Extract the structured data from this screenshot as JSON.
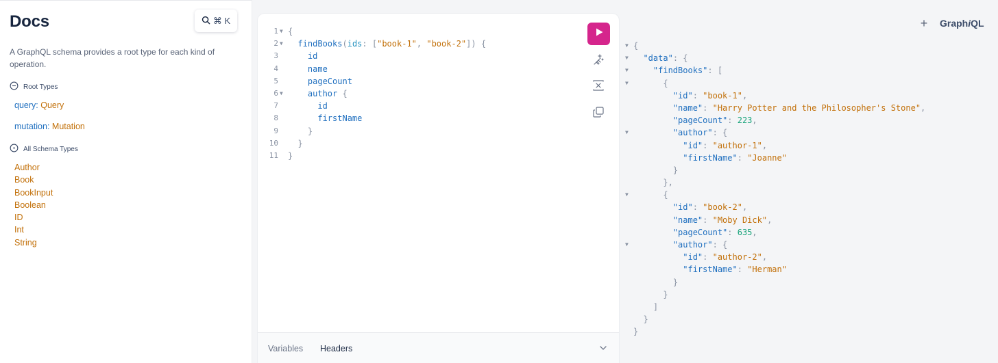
{
  "docs": {
    "title": "Docs",
    "search_label": "⌘ K",
    "description": "A GraphQL schema provides a root type for each kind of operation.",
    "root_types_heading": "Root Types",
    "root_fields": [
      {
        "name": "query",
        "type": "Query"
      },
      {
        "name": "mutation",
        "type": "Mutation"
      }
    ],
    "all_types_heading": "All Schema Types",
    "types": [
      "Author",
      "Book",
      "BookInput",
      "Boolean",
      "ID",
      "Int",
      "String"
    ]
  },
  "editor": {
    "query_lines": [
      {
        "n": "1",
        "fold": true,
        "tokens": [
          {
            "t": "{",
            "c": "k-punc"
          }
        ]
      },
      {
        "n": "2",
        "fold": true,
        "tokens": [
          {
            "t": "  "
          },
          {
            "t": "findBooks",
            "c": "k-field"
          },
          {
            "t": "(",
            "c": "k-punc"
          },
          {
            "t": "ids",
            "c": "k-arg"
          },
          {
            "t": ": ",
            "c": "k-punc"
          },
          {
            "t": "[",
            "c": "k-punc"
          },
          {
            "t": "\"book-1\"",
            "c": "k-str"
          },
          {
            "t": ", ",
            "c": "k-punc"
          },
          {
            "t": "\"book-2\"",
            "c": "k-str"
          },
          {
            "t": "]) {",
            "c": "k-punc"
          }
        ]
      },
      {
        "n": "3",
        "fold": false,
        "tokens": [
          {
            "t": "    "
          },
          {
            "t": "id",
            "c": "k-field"
          }
        ]
      },
      {
        "n": "4",
        "fold": false,
        "tokens": [
          {
            "t": "    "
          },
          {
            "t": "name",
            "c": "k-field"
          }
        ]
      },
      {
        "n": "5",
        "fold": false,
        "tokens": [
          {
            "t": "    "
          },
          {
            "t": "pageCount",
            "c": "k-field"
          }
        ]
      },
      {
        "n": "6",
        "fold": true,
        "tokens": [
          {
            "t": "    "
          },
          {
            "t": "author",
            "c": "k-field"
          },
          {
            "t": " {",
            "c": "k-punc"
          }
        ]
      },
      {
        "n": "7",
        "fold": false,
        "tokens": [
          {
            "t": "      "
          },
          {
            "t": "id",
            "c": "k-field"
          }
        ]
      },
      {
        "n": "8",
        "fold": false,
        "tokens": [
          {
            "t": "      "
          },
          {
            "t": "firstName",
            "c": "k-field"
          }
        ]
      },
      {
        "n": "9",
        "fold": false,
        "tokens": [
          {
            "t": "    "
          },
          {
            "t": "}",
            "c": "k-punc"
          }
        ]
      },
      {
        "n": "10",
        "fold": false,
        "tokens": [
          {
            "t": "  "
          },
          {
            "t": "}",
            "c": "k-punc"
          }
        ]
      },
      {
        "n": "11",
        "fold": false,
        "tokens": [
          {
            "t": "}",
            "c": "k-punc"
          }
        ]
      }
    ],
    "tabs": {
      "variables": "Variables",
      "headers": "Headers"
    }
  },
  "header": {
    "plus": "+",
    "logo_prefix": "Graph",
    "logo_italic": "i",
    "logo_suffix": "QL"
  },
  "result_lines": [
    {
      "fold": true,
      "tokens": [
        {
          "t": "{",
          "c": "k-punc"
        }
      ]
    },
    {
      "fold": true,
      "tokens": [
        {
          "t": "  "
        },
        {
          "t": "\"data\"",
          "c": "k-field"
        },
        {
          "t": ": {",
          "c": "k-punc"
        }
      ]
    },
    {
      "fold": true,
      "tokens": [
        {
          "t": "    "
        },
        {
          "t": "\"findBooks\"",
          "c": "k-field"
        },
        {
          "t": ": [",
          "c": "k-punc"
        }
      ]
    },
    {
      "fold": true,
      "tokens": [
        {
          "t": "      "
        },
        {
          "t": "{",
          "c": "k-punc"
        }
      ]
    },
    {
      "fold": false,
      "tokens": [
        {
          "t": "        "
        },
        {
          "t": "\"id\"",
          "c": "k-field"
        },
        {
          "t": ": ",
          "c": "k-punc"
        },
        {
          "t": "\"book-1\"",
          "c": "k-str"
        },
        {
          "t": ",",
          "c": "k-punc"
        }
      ]
    },
    {
      "fold": false,
      "tokens": [
        {
          "t": "        "
        },
        {
          "t": "\"name\"",
          "c": "k-field"
        },
        {
          "t": ": ",
          "c": "k-punc"
        },
        {
          "t": "\"Harry Potter and the Philosopher's Stone\"",
          "c": "k-str"
        },
        {
          "t": ",",
          "c": "k-punc"
        }
      ]
    },
    {
      "fold": false,
      "tokens": [
        {
          "t": "        "
        },
        {
          "t": "\"pageCount\"",
          "c": "k-field"
        },
        {
          "t": ": ",
          "c": "k-punc"
        },
        {
          "t": "223",
          "c": "k-num"
        },
        {
          "t": ",",
          "c": "k-punc"
        }
      ]
    },
    {
      "fold": true,
      "tokens": [
        {
          "t": "        "
        },
        {
          "t": "\"author\"",
          "c": "k-field"
        },
        {
          "t": ": {",
          "c": "k-punc"
        }
      ]
    },
    {
      "fold": false,
      "tokens": [
        {
          "t": "          "
        },
        {
          "t": "\"id\"",
          "c": "k-field"
        },
        {
          "t": ": ",
          "c": "k-punc"
        },
        {
          "t": "\"author-1\"",
          "c": "k-str"
        },
        {
          "t": ",",
          "c": "k-punc"
        }
      ]
    },
    {
      "fold": false,
      "tokens": [
        {
          "t": "          "
        },
        {
          "t": "\"firstName\"",
          "c": "k-field"
        },
        {
          "t": ": ",
          "c": "k-punc"
        },
        {
          "t": "\"Joanne\"",
          "c": "k-str"
        }
      ]
    },
    {
      "fold": false,
      "tokens": [
        {
          "t": "        "
        },
        {
          "t": "}",
          "c": "k-punc"
        }
      ]
    },
    {
      "fold": false,
      "tokens": [
        {
          "t": "      "
        },
        {
          "t": "},",
          "c": "k-punc"
        }
      ]
    },
    {
      "fold": true,
      "tokens": [
        {
          "t": "      "
        },
        {
          "t": "{",
          "c": "k-punc"
        }
      ]
    },
    {
      "fold": false,
      "tokens": [
        {
          "t": "        "
        },
        {
          "t": "\"id\"",
          "c": "k-field"
        },
        {
          "t": ": ",
          "c": "k-punc"
        },
        {
          "t": "\"book-2\"",
          "c": "k-str"
        },
        {
          "t": ",",
          "c": "k-punc"
        }
      ]
    },
    {
      "fold": false,
      "tokens": [
        {
          "t": "        "
        },
        {
          "t": "\"name\"",
          "c": "k-field"
        },
        {
          "t": ": ",
          "c": "k-punc"
        },
        {
          "t": "\"Moby Dick\"",
          "c": "k-str"
        },
        {
          "t": ",",
          "c": "k-punc"
        }
      ]
    },
    {
      "fold": false,
      "tokens": [
        {
          "t": "        "
        },
        {
          "t": "\"pageCount\"",
          "c": "k-field"
        },
        {
          "t": ": ",
          "c": "k-punc"
        },
        {
          "t": "635",
          "c": "k-num"
        },
        {
          "t": ",",
          "c": "k-punc"
        }
      ]
    },
    {
      "fold": true,
      "tokens": [
        {
          "t": "        "
        },
        {
          "t": "\"author\"",
          "c": "k-field"
        },
        {
          "t": ": {",
          "c": "k-punc"
        }
      ]
    },
    {
      "fold": false,
      "tokens": [
        {
          "t": "          "
        },
        {
          "t": "\"id\"",
          "c": "k-field"
        },
        {
          "t": ": ",
          "c": "k-punc"
        },
        {
          "t": "\"author-2\"",
          "c": "k-str"
        },
        {
          "t": ",",
          "c": "k-punc"
        }
      ]
    },
    {
      "fold": false,
      "tokens": [
        {
          "t": "          "
        },
        {
          "t": "\"firstName\"",
          "c": "k-field"
        },
        {
          "t": ": ",
          "c": "k-punc"
        },
        {
          "t": "\"Herman\"",
          "c": "k-str"
        }
      ]
    },
    {
      "fold": false,
      "tokens": [
        {
          "t": "        "
        },
        {
          "t": "}",
          "c": "k-punc"
        }
      ]
    },
    {
      "fold": false,
      "tokens": [
        {
          "t": "      "
        },
        {
          "t": "}",
          "c": "k-punc"
        }
      ]
    },
    {
      "fold": false,
      "tokens": [
        {
          "t": "    "
        },
        {
          "t": "]",
          "c": "k-punc"
        }
      ]
    },
    {
      "fold": false,
      "tokens": [
        {
          "t": "  "
        },
        {
          "t": "}",
          "c": "k-punc"
        }
      ]
    },
    {
      "fold": false,
      "tokens": [
        {
          "t": "}",
          "c": "k-punc"
        }
      ]
    }
  ],
  "colors": {
    "accent": "#d5258c",
    "field": "#1f6fbf",
    "string": "#c27009",
    "number": "#17a37a",
    "punctuation": "#8a93a3"
  },
  "icons": [
    "search-icon",
    "collapse-circle-icon",
    "expand-circle-icon",
    "play-icon",
    "prettify-icon",
    "merge-icon",
    "copy-icon",
    "chevron-down-icon",
    "plus-icon"
  ]
}
